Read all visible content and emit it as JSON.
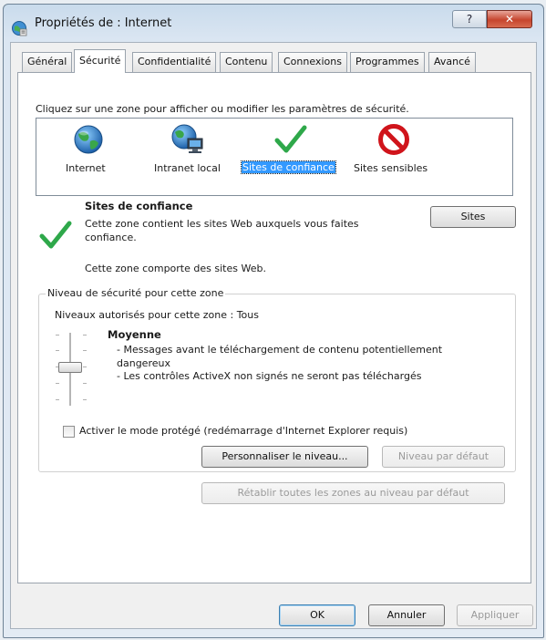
{
  "window": {
    "title": "Propriétés de : Internet",
    "help_glyph": "?",
    "close_glyph": "✕"
  },
  "tabs": [
    {
      "label": "Général"
    },
    {
      "label": "Sécurité"
    },
    {
      "label": "Confidentialité"
    },
    {
      "label": "Contenu"
    },
    {
      "label": "Connexions"
    },
    {
      "label": "Programmes"
    },
    {
      "label": "Avancé"
    }
  ],
  "active_tab": "Sécurité",
  "zones": {
    "instruction": "Cliquez sur une zone pour afficher ou modifier les paramètres de sécurité.",
    "items": [
      {
        "label": "Internet",
        "icon": "globe-icon"
      },
      {
        "label": "Intranet local",
        "icon": "network-globe-icon"
      },
      {
        "label": "Sites de confiance",
        "icon": "checkmark-icon"
      },
      {
        "label": "Sites sensibles",
        "icon": "restricted-icon"
      }
    ],
    "selected": "Sites de confiance"
  },
  "zone_info": {
    "title": "Sites de confiance",
    "description": "Cette zone contient les sites Web auxquels vous faites confiance.",
    "note": "Cette zone comporte des sites Web.",
    "sites_button": "Sites"
  },
  "security_level": {
    "group_label": "Niveau de sécurité pour cette zone",
    "allowed_text": "Niveaux autorisés pour cette zone : Tous",
    "level_name": "Moyenne",
    "bullets": [
      "- Messages avant le téléchargement de contenu potentiellement dangereux",
      "- Les contrôles ActiveX non signés ne seront pas téléchargés"
    ],
    "protected_mode_label": "Activer le mode protégé (redémarrage d'Internet Explorer requis)",
    "protected_mode_checked": false,
    "custom_level_button": "Personnaliser le niveau...",
    "default_level_button": "Niveau par défaut",
    "reset_all_button": "Rétablir toutes les zones au niveau par défaut"
  },
  "footer": {
    "ok": "OK",
    "cancel": "Annuler",
    "apply": "Appliquer"
  },
  "colors": {
    "selection": "#3399ff",
    "check_green": "#2ea84a",
    "restricted_red": "#d0141b"
  }
}
